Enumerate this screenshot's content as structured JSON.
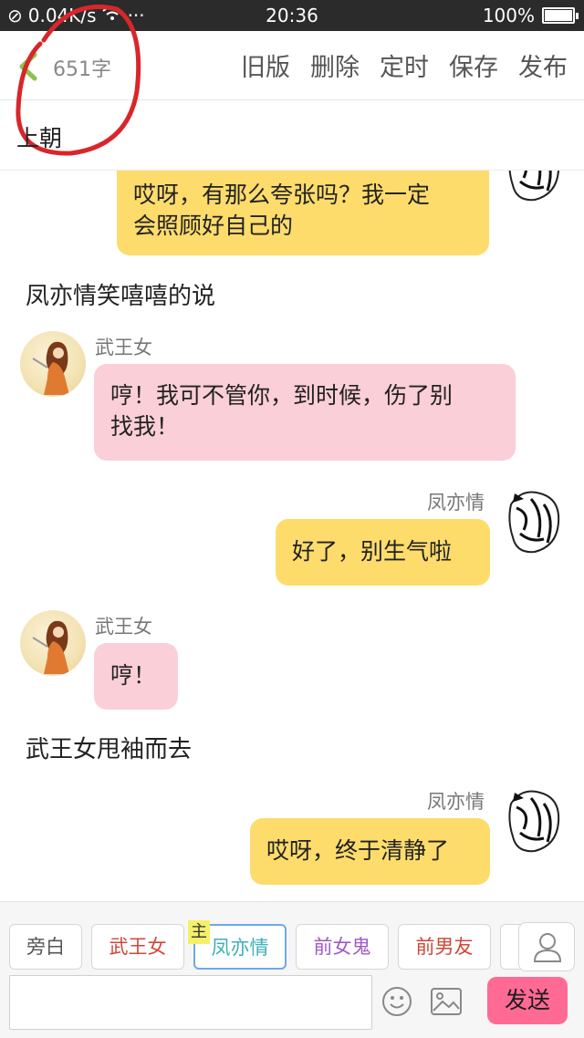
{
  "status_bar": {
    "network_speed": "0.04K/s",
    "more": "···",
    "time": "20:36",
    "battery": "100%",
    "battery_level": 1.0
  },
  "toolbar": {
    "word_count": "651字",
    "actions": [
      "旧版",
      "删除",
      "定时",
      "保存",
      "发布"
    ]
  },
  "chapter": {
    "title": "上朝"
  },
  "chat": {
    "messages": [
      {
        "type": "bubble",
        "side": "right",
        "color": "#fddc6c",
        "lines": [
          "哎呀，有那么夸张吗？我一定",
          "会照顾好自己的"
        ]
      },
      {
        "type": "narration",
        "text": "凤亦情笑嘻嘻的说"
      },
      {
        "type": "bubble",
        "side": "left",
        "speaker": "武王女",
        "color": "#fbcfd7",
        "lines": [
          "哼！我可不管你，到时候，伤了别",
          "找我！"
        ]
      },
      {
        "type": "bubble",
        "side": "right",
        "speaker": "凤亦情",
        "color": "#fddc6c",
        "lines": [
          "好了，别生气啦"
        ]
      },
      {
        "type": "bubble",
        "side": "left",
        "speaker": "武王女",
        "color": "#fbcfd7",
        "lines": [
          "哼！"
        ]
      },
      {
        "type": "narration",
        "text": "武王女甩袖而去"
      },
      {
        "type": "bubble",
        "side": "right",
        "speaker": "凤亦情",
        "color": "#fddc6c",
        "lines": [
          "哎呀，终于清静了"
        ]
      }
    ]
  },
  "bottom": {
    "roles": [
      {
        "label": "旁白",
        "color": "#555555"
      },
      {
        "label": "武王女",
        "color": "#d2463a"
      },
      {
        "label": "凤亦情",
        "color": "#3cb0b8",
        "active": true
      },
      {
        "label": "前女鬼",
        "color": "#a05ac8"
      },
      {
        "label": "前男友",
        "color": "#d2463a"
      }
    ],
    "main_badge": "主",
    "send_label": "发送"
  },
  "colors": {
    "accent_send": "#ff6a95",
    "bubble_right": "#fddc6c",
    "bubble_left": "#fbcfd7",
    "annotation_circle": "#d8262a"
  }
}
